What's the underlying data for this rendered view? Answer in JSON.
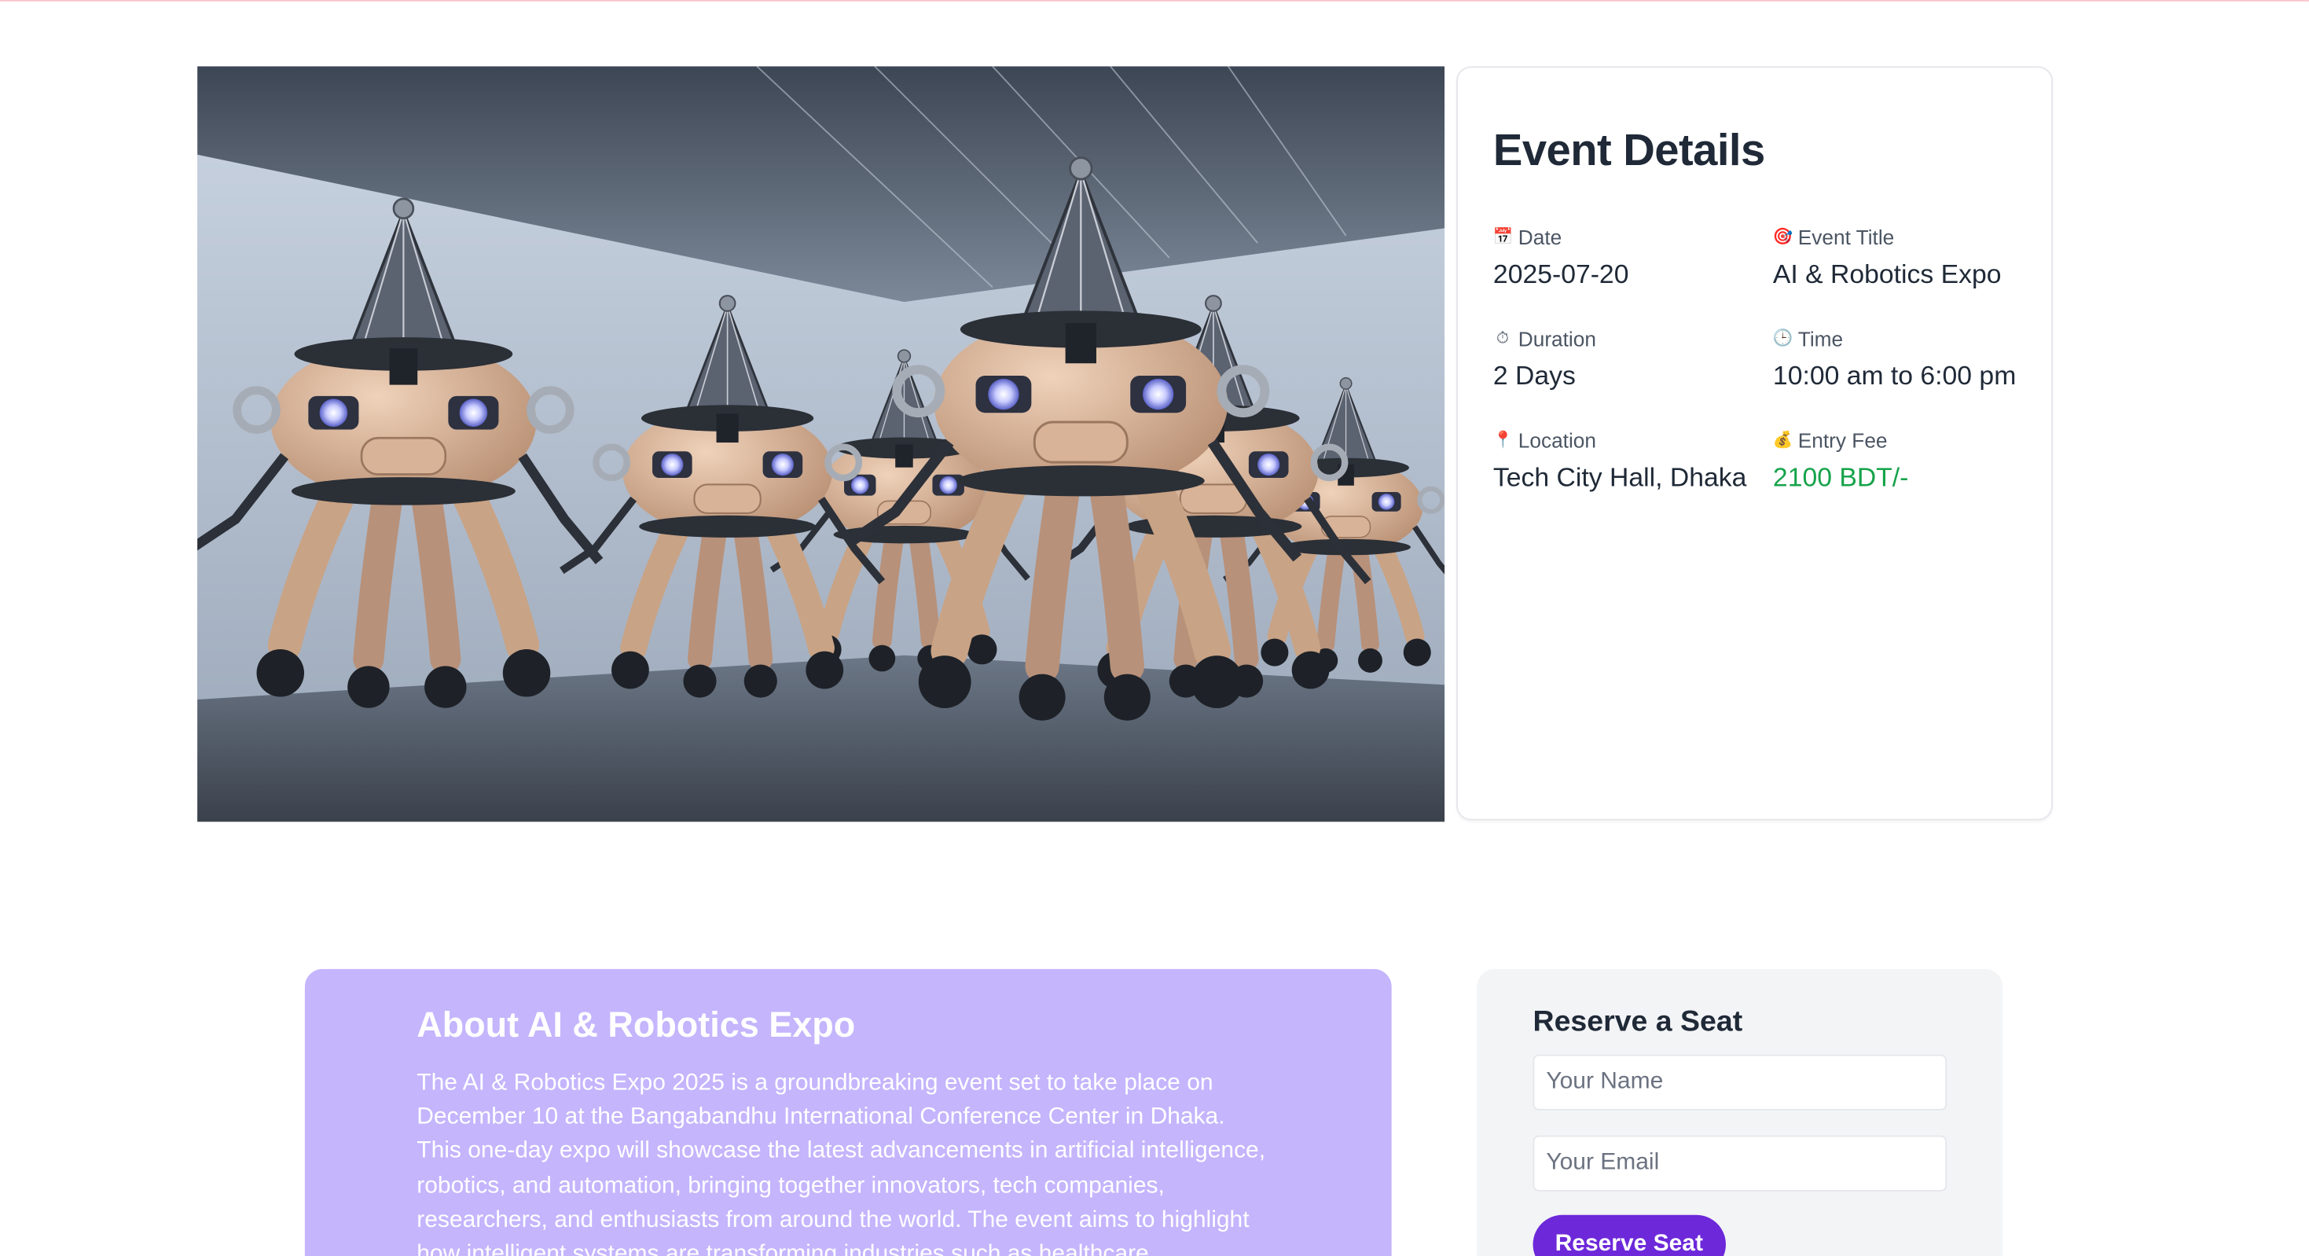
{
  "event_details": {
    "title": "Event Details",
    "items": [
      {
        "icon": "calendar-icon",
        "label": "Date",
        "value": "2025-07-20"
      },
      {
        "icon": "target-icon",
        "label": "Event Title",
        "value": "AI & Robotics Expo"
      },
      {
        "icon": "stopwatch-icon",
        "label": "Duration",
        "value": "2 Days"
      },
      {
        "icon": "clock-icon",
        "label": "Time",
        "value": "10:00 am to 6:00 pm"
      },
      {
        "icon": "location-pin-icon",
        "label": "Location",
        "value": "Tech City Hall, Dhaka"
      },
      {
        "icon": "money-bag-icon",
        "label": "Entry Fee",
        "value": "2100 BDT/-"
      }
    ]
  },
  "about": {
    "title": "About AI & Robotics Expo",
    "text": "The AI & Robotics Expo 2025 is a groundbreaking event set to take place on December 10 at the Bangabandhu International Conference Center in Dhaka. This one-day expo will showcase the latest advancements in artificial intelligence, robotics, and automation, bringing together innovators, tech companies, researchers, and enthusiasts from around the world. The event aims to highlight how intelligent systems are transforming industries such as healthcare"
  },
  "reserve": {
    "title": "Reserve a Seat",
    "name_placeholder": "Your Name",
    "email_placeholder": "Your Email",
    "button_label": "Reserve Seat"
  },
  "colors": {
    "accent": "#6d28d9",
    "about_bg": "#c4b5fd",
    "fee": "#16a34a"
  }
}
